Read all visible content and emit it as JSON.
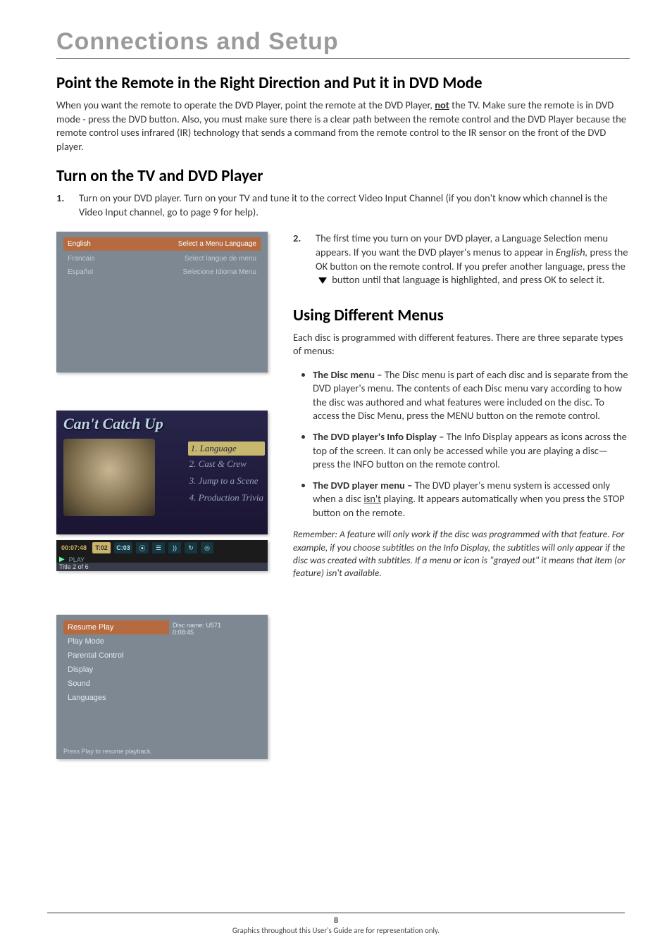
{
  "chapter": "Connections and Setup",
  "section1": {
    "title": "Point the Remote in the Right Direction and Put it in DVD Mode",
    "body_before_not": "When you want the remote to operate the DVD Player, point the remote at the DVD Player, ",
    "not": "not",
    "body_after_not": " the TV. Make sure the remote is in DVD mode - press the DVD button. Also, you must make sure there is a clear path between the remote control and the DVD Player because the remote control uses infrared (IR) technology that sends a command from the remote control to the IR sensor on the front of the DVD player."
  },
  "section2": {
    "title": "Turn on the TV and DVD Player",
    "step1_num": "1.",
    "step1_text": "Turn on your DVD player. Turn on your TV and tune it to the correct Video Input Channel (if you don't know which channel is the Video Input channel, go to page 9 for help).",
    "step2_num": "2.",
    "step2_text_a": "The first time you turn on your DVD player, a Language Selection menu appears. If you want the DVD player's menus to appear in ",
    "step2_text_english": "English,",
    "step2_text_b": " press the OK button on the remote control. If you prefer another language, press the ",
    "step2_text_c": " button until that language is highlighted, and press OK to select it."
  },
  "section3": {
    "title": "Using Different Menus",
    "intro": "Each disc is programmed with different features. There are three separate types of menus:",
    "bullets": [
      {
        "lead": "The Disc menu – ",
        "text": "The Disc menu is part of each disc and is separate from the DVD player's menu. The contents of each Disc menu vary according to how the disc was authored and what features were included on the disc. To access the Disc Menu, press the MENU button on the remote control."
      },
      {
        "lead": "The DVD player's Info Display – ",
        "text": "The Info Display appears as icons across the top of the screen. It can only be accessed while you are playing a disc—press the INFO button on the remote control."
      },
      {
        "lead": "The DVD player menu – ",
        "text_a": "The DVD player's menu system is accessed only when a disc ",
        "isnt": "isn't",
        "text_b": " playing. It appears automatically when you press the STOP button on the remote."
      }
    ],
    "note": "Remember: A feature will only work if the disc was programmed with that feature. For example, if you choose subtitles on the Info Display, the subtitles will only appear if the disc was created with subtitles. If a menu or icon is \"grayed out\" it means that item (or feature) isn't available."
  },
  "fig_lang": {
    "rows": [
      {
        "l": "English",
        "r": "Select a Menu Language"
      },
      {
        "l": "Francais",
        "r": "Select langue de menu"
      },
      {
        "l": "Español",
        "r": "Selecione Idioma Menu"
      }
    ]
  },
  "fig_disc": {
    "title": "Can't Catch Up",
    "opts": [
      "1. Language",
      "2. Cast & Crew",
      "3. Jump to a Scene",
      "4. Production Trivia"
    ]
  },
  "fig_info": {
    "time": "00:07:48",
    "t": "T:02",
    "c": "C:03",
    "play": "PLAY",
    "title2": "Title 2 of 6"
  },
  "fig_player": {
    "items": [
      "Resume Play",
      "Play Mode",
      "Parental Control",
      "Display",
      "Sound",
      "Languages"
    ],
    "disc_line1": "Disc name: U571",
    "disc_line2": "0:08:45",
    "hint": "Press Play to resume playback."
  },
  "footer": {
    "page": "8",
    "note": "Graphics throughout this User's Guide are for representation only."
  }
}
